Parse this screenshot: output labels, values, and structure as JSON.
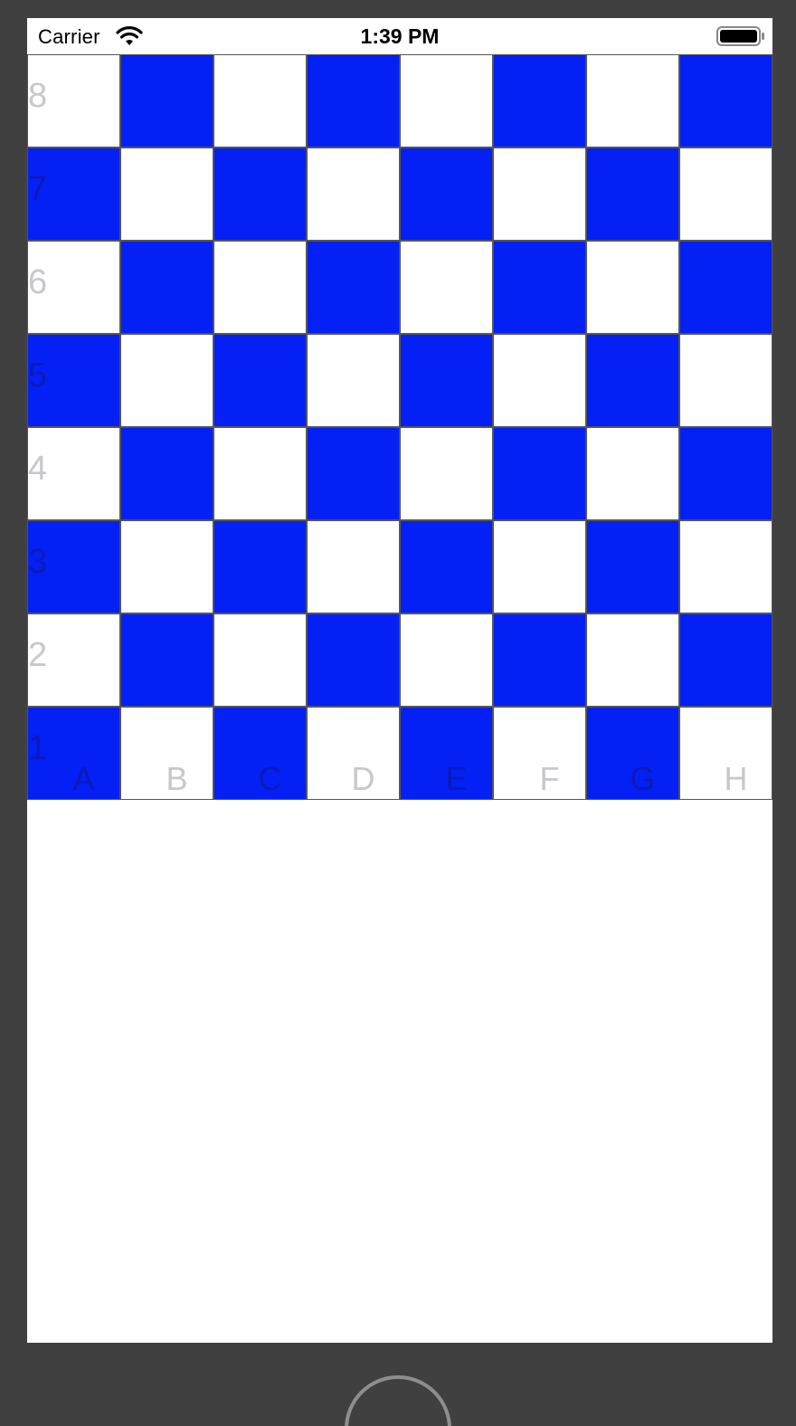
{
  "status_bar": {
    "carrier": "Carrier",
    "time": "1:39 PM",
    "icons": [
      "wifi-icon",
      "battery-icon"
    ]
  },
  "board": {
    "ranks": [
      "8",
      "7",
      "6",
      "5",
      "4",
      "3",
      "2",
      "1"
    ],
    "files": [
      "A",
      "B",
      "C",
      "D",
      "E",
      "F",
      "G",
      "H"
    ],
    "colors": {
      "light_square": "#ffffff",
      "dark_square": "#0420F5",
      "label_on_light": "#c8c8cc",
      "label_on_dark": "#0a1bb8",
      "grid_line": "#555555"
    }
  },
  "colors": {
    "device_frame": "#404040",
    "screen_background": "#ffffff"
  }
}
